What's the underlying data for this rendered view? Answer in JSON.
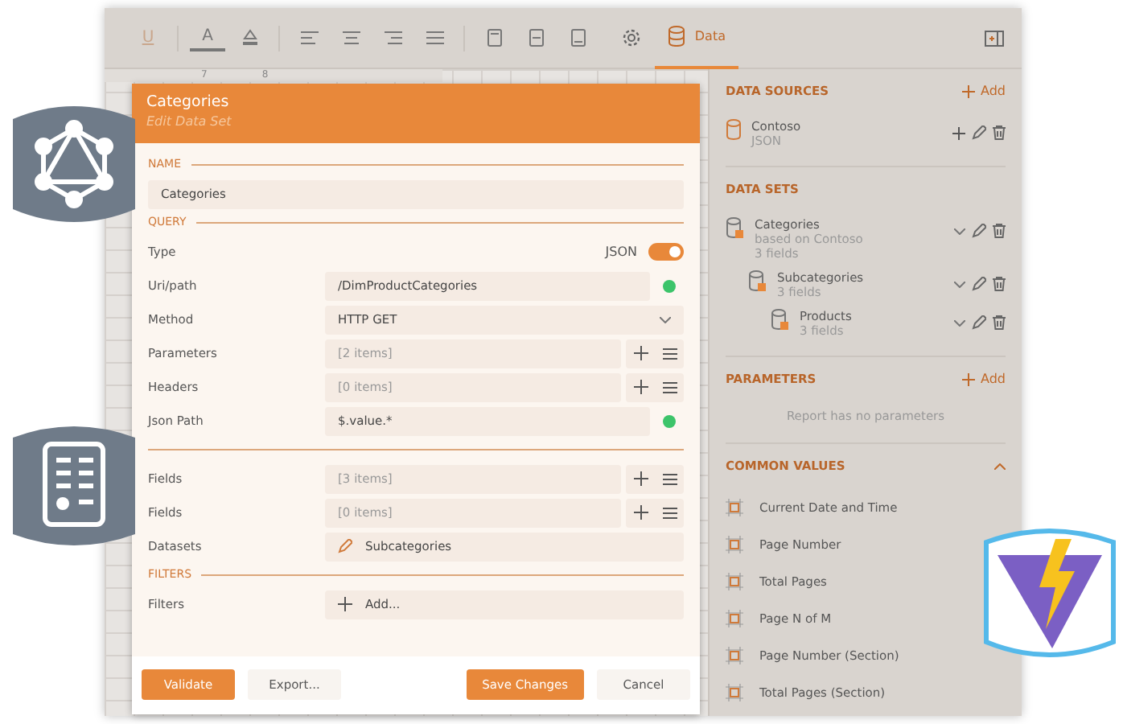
{
  "toolbar": {
    "tools": [
      {
        "kind": "glyph",
        "glyph": "U",
        "disabled": true
      },
      {
        "kind": "color",
        "glyph": "A",
        "disabled": false
      },
      {
        "kind": "highlight",
        "disabled": false
      },
      {
        "kind": "align-left",
        "disabled": false
      },
      {
        "kind": "align-center",
        "disabled": false
      },
      {
        "kind": "align-right",
        "disabled": false
      },
      {
        "kind": "justify",
        "disabled": false
      },
      {
        "kind": "page-top",
        "disabled": false
      },
      {
        "kind": "page-middle",
        "disabled": false
      },
      {
        "kind": "page-bottom",
        "disabled": false
      }
    ],
    "tabs": [
      {
        "kind": "settings",
        "selected": false
      },
      {
        "kind": "data",
        "label": "Data",
        "selected": true
      }
    ]
  },
  "ruler": {
    "labels": [
      "7",
      "8"
    ]
  },
  "dialog": {
    "title": "Categories",
    "subtitle": "Edit Data Set",
    "sections": [
      {
        "heading": "NAME",
        "rows": [
          {
            "kind": "text",
            "value": "Categories"
          }
        ]
      },
      {
        "heading": "QUERY",
        "rows": [
          {
            "kind": "toggle",
            "label": "Type",
            "value": "JSON",
            "on": true
          },
          {
            "kind": "status",
            "label": "Uri/path",
            "value": "/DimProductCategories",
            "valid": true
          },
          {
            "kind": "select",
            "label": "Method",
            "value": "HTTP GET"
          },
          {
            "kind": "list",
            "label": "Parameters",
            "value": "[2 items]"
          },
          {
            "kind": "list",
            "label": "Headers",
            "value": "[0 items]"
          },
          {
            "kind": "status",
            "label": "Json Path",
            "value": "$.value.*",
            "valid": true
          }
        ]
      },
      {
        "rows": [
          {
            "kind": "list",
            "label": "Fields",
            "value": "[3 items]"
          },
          {
            "kind": "list",
            "label": "Fields",
            "value": "[0 items]"
          },
          {
            "kind": "link",
            "label": "Datasets",
            "value": "Subcategories"
          }
        ]
      },
      {
        "heading": "FILTERS",
        "rows": [
          {
            "kind": "add",
            "label": "Filters",
            "value": "Add..."
          }
        ]
      }
    ],
    "buttons_left": [
      {
        "label": "Validate",
        "kind": "primary"
      },
      {
        "label": "Export...",
        "kind": "secondary"
      }
    ],
    "buttons_right": [
      {
        "label": "Save Changes",
        "kind": "primary"
      },
      {
        "label": "Cancel",
        "kind": "secondary"
      }
    ]
  },
  "data_sources": {
    "heading": "DATA SOURCES",
    "add_label": "Add",
    "items": [
      {
        "name": "Contoso",
        "details": [
          "JSON"
        ]
      }
    ]
  },
  "data_sets": {
    "heading": "DATA SETS",
    "items": [
      {
        "name": "Categories",
        "details": [
          "based on Contoso",
          "3 fields"
        ],
        "children": [
          {
            "name": "Subcategories",
            "details": [
              "3 fields"
            ],
            "children": [
              {
                "name": "Products",
                "details": [
                  "3 fields"
                ]
              }
            ]
          }
        ]
      }
    ]
  },
  "parameters": {
    "heading": "PARAMETERS",
    "add_label": "Add",
    "empty_text": "Report has no parameters"
  },
  "common_values": {
    "heading": "COMMON VALUES",
    "expanded": true,
    "items": [
      "Current Date and Time",
      "Page Number",
      "Total Pages",
      "Page N of M",
      "Page Number (Section)",
      "Total Pages (Section)"
    ]
  }
}
